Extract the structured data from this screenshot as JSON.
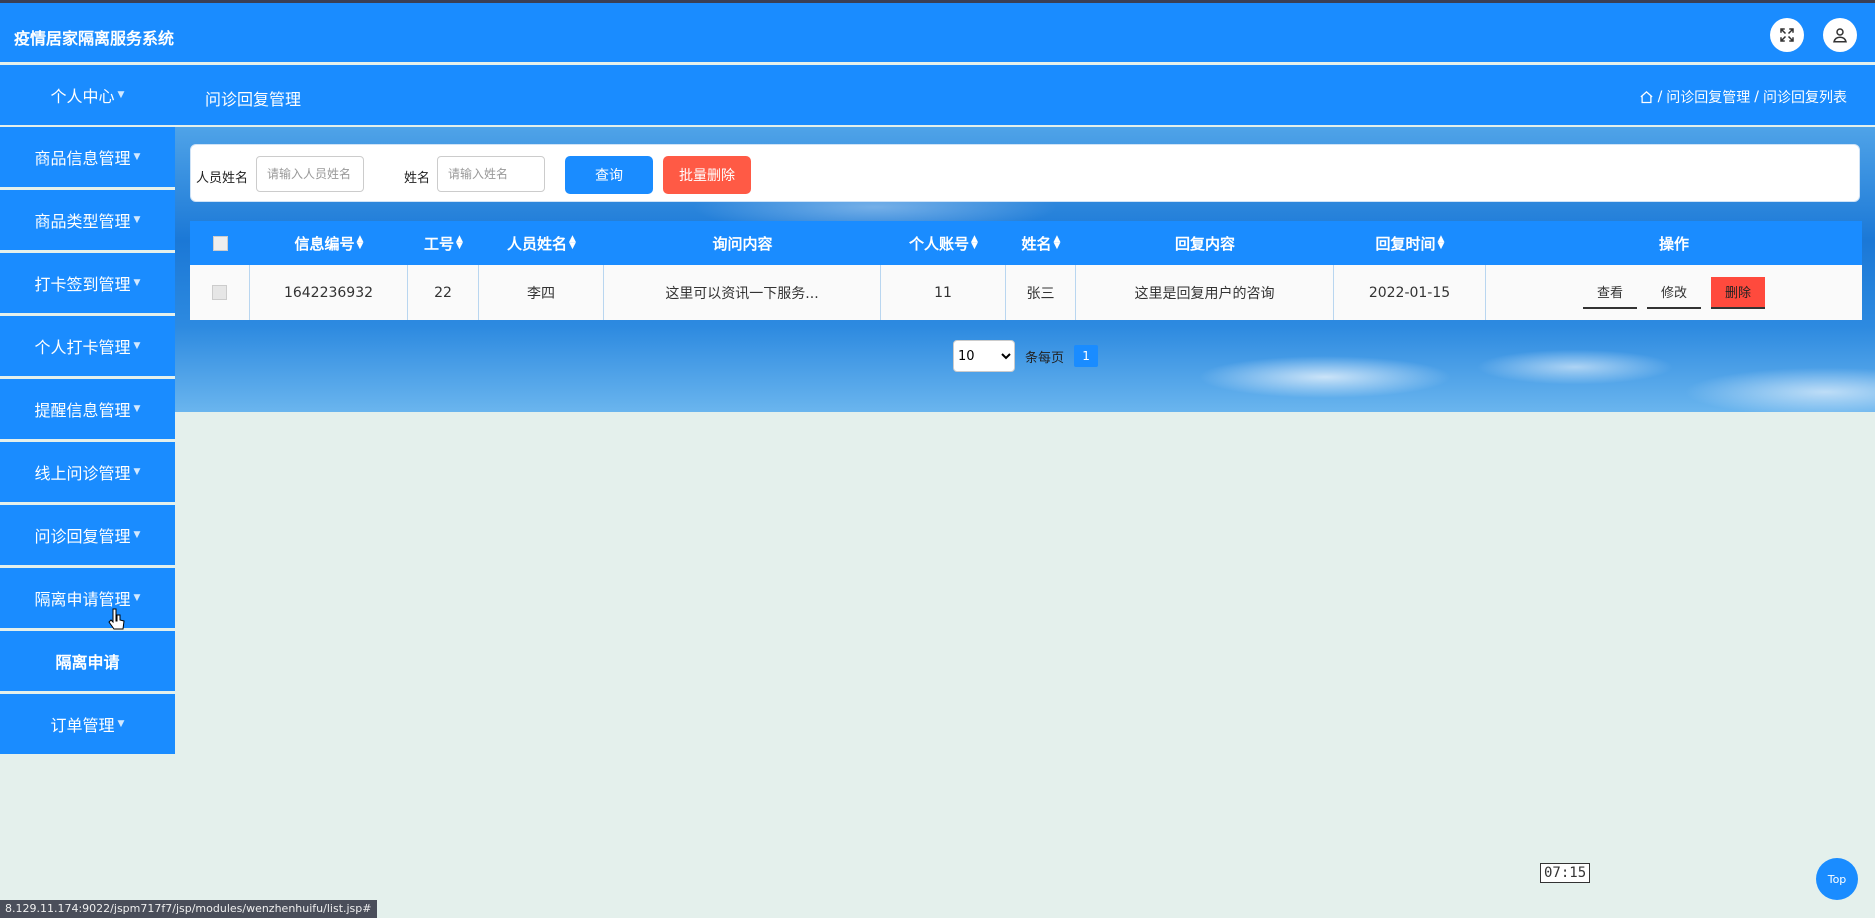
{
  "app": {
    "title": "疫情居家隔离服务系统"
  },
  "header": {
    "personal_center": "个人中心",
    "page_title": "问诊回复管理",
    "breadcrumb": [
      "问诊回复管理",
      "问诊回复列表"
    ]
  },
  "sidebar": {
    "items": [
      {
        "label": "商品信息管理"
      },
      {
        "label": "商品类型管理"
      },
      {
        "label": "打卡签到管理"
      },
      {
        "label": "个人打卡管理"
      },
      {
        "label": "提醒信息管理"
      },
      {
        "label": "线上问诊管理"
      },
      {
        "label": "问诊回复管理"
      },
      {
        "label": "隔离申请管理"
      },
      {
        "label": "隔离申请"
      },
      {
        "label": "订单管理"
      }
    ]
  },
  "search": {
    "person_name_label": "人员姓名",
    "person_name_placeholder": "请输入人员姓名",
    "name_label": "姓名",
    "name_placeholder": "请输入姓名",
    "query_button": "查询",
    "batch_delete_button": "批量删除"
  },
  "table": {
    "columns": [
      "信息编号",
      "工号",
      "人员姓名",
      "询问内容",
      "个人账号",
      "姓名",
      "回复内容",
      "回复时间",
      "操作"
    ],
    "rows": [
      {
        "id": "1642236932",
        "job_no": "22",
        "person_name": "李四",
        "inquiry": "这里可以资讯一下服务...",
        "account": "11",
        "name": "张三",
        "reply": "这里是回复用户的咨询",
        "reply_time": "2022-01-15",
        "actions": {
          "view": "查看",
          "edit": "修改",
          "delete": "删除"
        }
      }
    ]
  },
  "pagination": {
    "page_size": "10",
    "per_page_label": "条每页",
    "current_page": "1"
  },
  "overlay": {
    "timer": "07:15",
    "top_button": "Top",
    "status_url": "8.129.11.174:9022/jspm717f7/jsp/modules/wenzhenhuifu/list.jsp#"
  },
  "colors": {
    "primary": "#1a8cff",
    "danger": "#ff5a45"
  }
}
